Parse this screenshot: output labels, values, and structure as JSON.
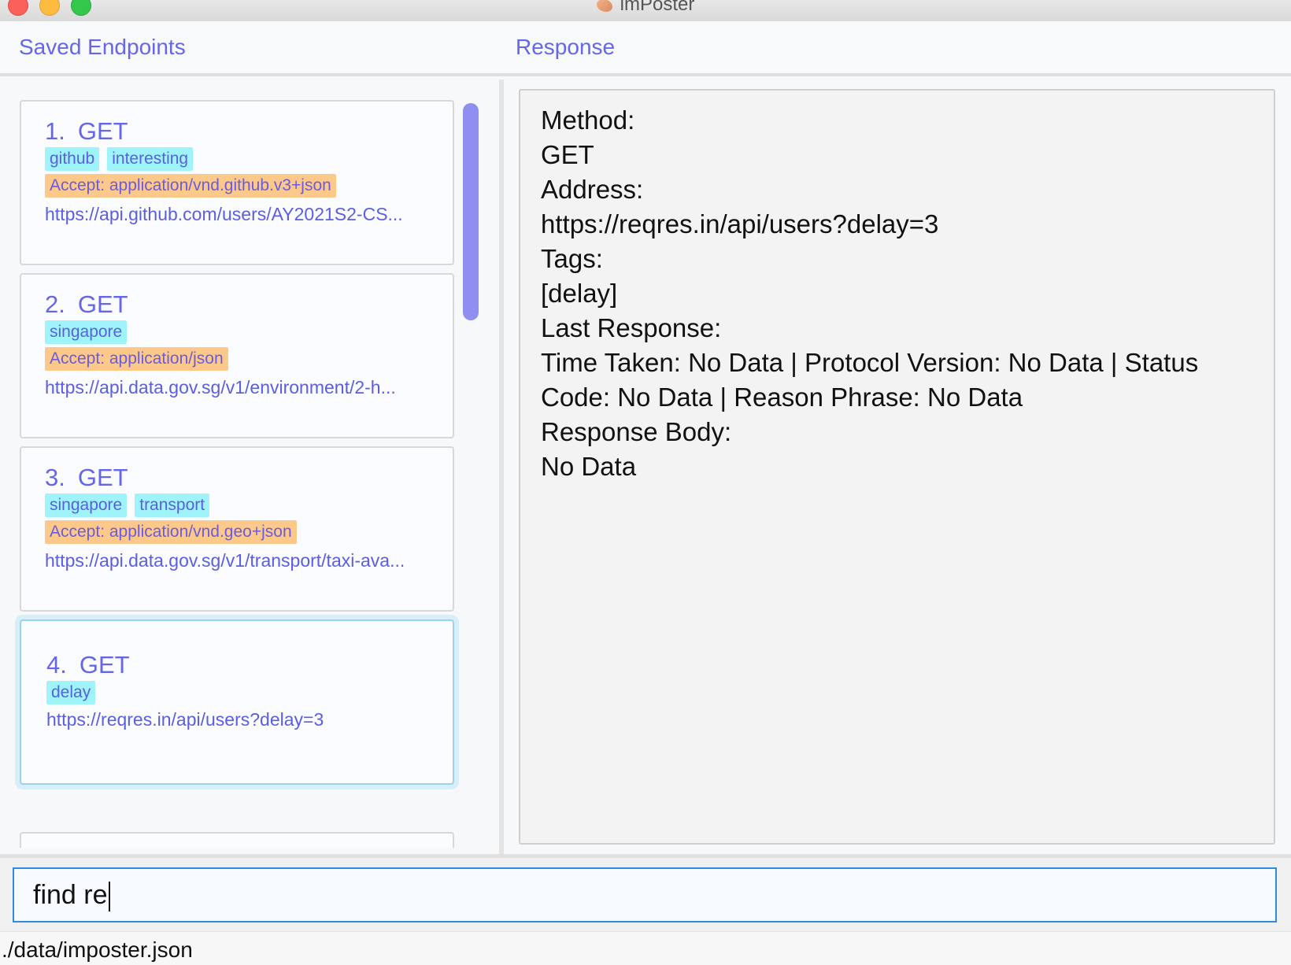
{
  "window": {
    "title": "imPoster"
  },
  "headers": {
    "left": "Saved Endpoints",
    "right": "Response"
  },
  "endpoints": [
    {
      "index": "1.",
      "method": "GET",
      "tags": [
        "github",
        "interesting"
      ],
      "header": "Accept: application/vnd.github.v3+json",
      "url": "https://api.github.com/users/AY2021S2-CS..."
    },
    {
      "index": "2.",
      "method": "GET",
      "tags": [
        "singapore"
      ],
      "header": "Accept: application/json",
      "url": "https://api.data.gov.sg/v1/environment/2-h..."
    },
    {
      "index": "3.",
      "method": "GET",
      "tags": [
        "singapore",
        "transport"
      ],
      "header": "Accept: application/vnd.geo+json",
      "url": "https://api.data.gov.sg/v1/transport/taxi-ava..."
    },
    {
      "index": "4.",
      "method": "GET",
      "tags": [
        "delay"
      ],
      "header": "",
      "url": "https://reqres.in/api/users?delay=3"
    }
  ],
  "response": {
    "method_label": "Method:",
    "method_value": "GET",
    "address_label": "Address:",
    "address_value": "https://reqres.in/api/users?delay=3",
    "tags_label": "Tags:",
    "tags_value": "[delay]",
    "last_response_label": "Last Response:",
    "last_response_line1": "Time Taken: No Data | Protocol Version: No Data | Status",
    "last_response_line2": "Code: No Data | Reason Phrase: No Data",
    "body_label": "Response Body:",
    "body_value": "No Data"
  },
  "command": {
    "value": "find re"
  },
  "status": {
    "file_path": "./data/imposter.json"
  },
  "colors": {
    "accent": "#6566e8",
    "tag_bg": "#9ff3fb",
    "header_chip_bg": "#fcc98a",
    "scrollbar": "#8e8ff0",
    "input_border": "#2e8be0"
  }
}
